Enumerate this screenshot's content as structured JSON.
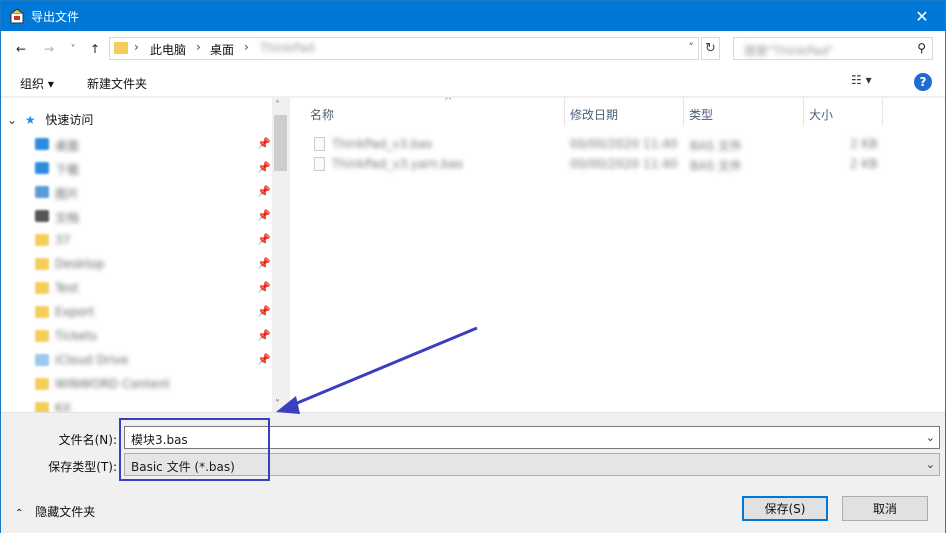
{
  "window": {
    "title": "导出文件",
    "close_glyph": "✕"
  },
  "nav": {
    "back_glyph": "←",
    "forward_glyph": "→",
    "recent_glyph": "˅",
    "up_glyph": "↑",
    "breadcrumbs": [
      "此电脑",
      "桌面",
      "ThinkPad"
    ],
    "breadcrumb_sep": "›",
    "addr_dropdown_glyph": "˅",
    "refresh_glyph": "↻",
    "search_placeholder": "搜索\"ThinkPad\"",
    "search_glyph": "⚲"
  },
  "toolbar": {
    "organize_label": "组织 ▾",
    "new_folder_label": "新建文件夹",
    "view_label": "☷ ▾",
    "help_label": "?"
  },
  "tree": {
    "quick_access": "快速访问",
    "quick_access_chevron": "⌄",
    "quick_access_star": "★",
    "pin_glyph": "📌",
    "scroll_up_glyph": "˄",
    "scroll_down_glyph": "˅",
    "items": [
      {
        "label": "桌面",
        "color": "#2c8de0",
        "pinned": true
      },
      {
        "label": "下载",
        "color": "#2c8de0",
        "pinned": true
      },
      {
        "label": "图片",
        "color": "#5b9bd5",
        "pinned": true
      },
      {
        "label": "文档",
        "color": "#555555",
        "pinned": true
      },
      {
        "label": "37",
        "color": "#f5cd5b",
        "pinned": true
      },
      {
        "label": "Desktop",
        "color": "#f5cd5b",
        "pinned": true
      },
      {
        "label": "Test",
        "color": "#f5cd5b",
        "pinned": true
      },
      {
        "label": "Export",
        "color": "#f5cd5b",
        "pinned": true
      },
      {
        "label": "Tickets",
        "color": "#f5cd5b",
        "pinned": true
      },
      {
        "label": "iCloud Drive",
        "color": "#9cc7ee",
        "pinned": true
      },
      {
        "label": "WINWORD Content",
        "color": "#f5cd5b",
        "pinned": false
      },
      {
        "label": "Kit",
        "color": "#f5cd5b",
        "pinned": false
      }
    ]
  },
  "files": {
    "columns": [
      "名称",
      "修改日期",
      "类型",
      "大小"
    ],
    "sort_glyph": "^",
    "rows": [
      {
        "name": "ThinkPad_v3.bas",
        "date": "00/00/2020 11:40",
        "type": "BAS 文件",
        "size": "2 KB"
      },
      {
        "name": "ThinkPad_v3.yarn.bas",
        "date": "00/00/2020 11:40",
        "type": "BAS 文件",
        "size": "2 KB"
      }
    ]
  },
  "save": {
    "filename_label": "文件名(N):",
    "filename_value": "模块3.bas",
    "filetype_label": "保存类型(T):",
    "filetype_value": "Basic 文件 (*.bas)",
    "dropdown_glyph": "⌄",
    "hide_folders_label": "隐藏文件夹",
    "hide_folders_chevron": "⌃",
    "save_button": "保存(S)",
    "cancel_button": "取消"
  },
  "colors": {
    "titlebar": "#0078d7",
    "annotation": "#3a3fc0",
    "folder": "#f5cd5b"
  }
}
